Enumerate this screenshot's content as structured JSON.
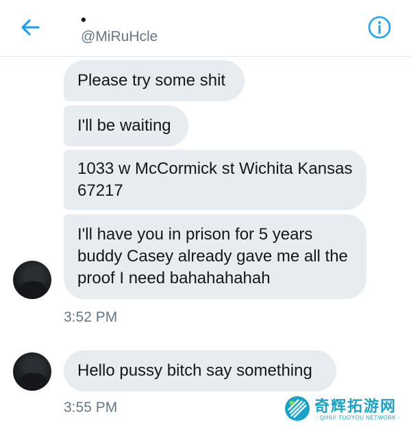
{
  "header": {
    "title": "•",
    "handle": "@MiRuHcle"
  },
  "messages": [
    {
      "text": "Please try some shit"
    },
    {
      "text": "I'll be waiting"
    },
    {
      "text": "1033 w McCormick st Wichita Kansas 67217"
    },
    {
      "text": "I'll have you in prison for 5 years buddy Casey already gave me all the proof I need bahahahahah"
    },
    {
      "text": "Hello pussy bitch say something"
    }
  ],
  "timestamps": [
    "3:52 PM",
    "3:55 PM"
  ],
  "watermark": {
    "name": "奇辉拓游网",
    "subtitle": "- QIHUI TUOYOU NETWORK -"
  },
  "colors": {
    "accent": "#1da1f2",
    "bubble": "#e6ecf0",
    "secondary_text": "#657786",
    "watermark": "#1aa3c8"
  }
}
